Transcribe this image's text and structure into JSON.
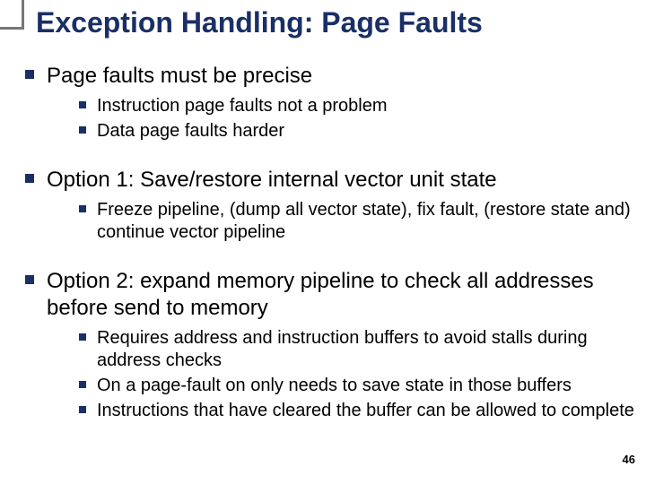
{
  "title": "Exception Handling: Page Faults",
  "page_number": "46",
  "bullets": {
    "b1": "Page faults must be precise",
    "b1a": "Instruction page faults not a problem",
    "b1b": "Data page faults harder",
    "b2": "Option 1: Save/restore internal vector unit state",
    "b2a": "Freeze pipeline, (dump all vector state), fix fault, (restore state and) continue vector pipeline",
    "b3": "Option 2: expand memory pipeline to check all addresses before send to memory",
    "b3a": "Requires address and instruction buffers to avoid stalls during address checks",
    "b3b": "On a page-fault on only needs to save state in those buffers",
    "b3c": "Instructions that have cleared the buffer can be allowed to complete"
  }
}
